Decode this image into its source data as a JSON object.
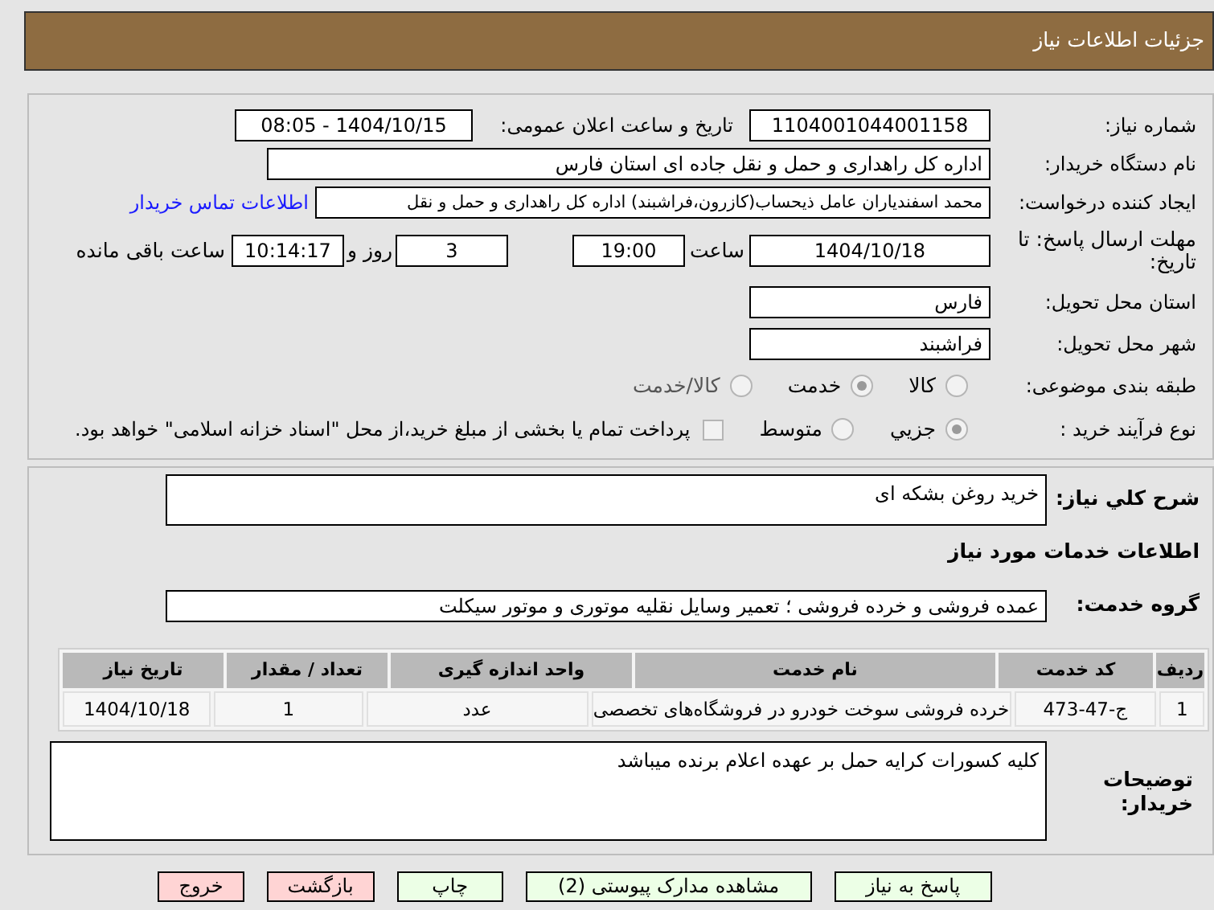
{
  "header": {
    "title": "جزئیات اطلاعات نیاز"
  },
  "need_number": {
    "label": "شماره نیاز:",
    "value": "1104001044001158"
  },
  "announce": {
    "label": "تاریخ و ساعت اعلان عمومی:",
    "value": "1404/10/15 - 08:05"
  },
  "buyer_org": {
    "label": "نام دستگاه خریدار:",
    "value": "اداره کل راهداری و حمل و نقل جاده ای استان فارس"
  },
  "requester": {
    "label": "ایجاد کننده درخواست:",
    "value": "محمد اسفندیاران عامل ذیحساب(کازرون،فراشبند) اداره کل راهداری و حمل و نقل",
    "link": "اطلاعات تماس خریدار"
  },
  "deadline": {
    "label": "مهلت ارسال پاسخ: تا تاریخ:",
    "date": "1404/10/18",
    "time_label": "ساعت",
    "time": "19:00",
    "days": "3",
    "days_label": "روز و",
    "remaining": "10:14:17",
    "remaining_label": "ساعت باقی مانده"
  },
  "province": {
    "label": "استان محل تحویل:",
    "value": "فارس"
  },
  "city": {
    "label": "شهر محل تحویل:",
    "value": "فراشبند"
  },
  "category": {
    "label": "طبقه بندی موضوعی:",
    "options": [
      {
        "label": "کالا",
        "selected": false,
        "disabled": false
      },
      {
        "label": "خدمت",
        "selected": true,
        "disabled": false
      },
      {
        "label": "کالا/خدمت",
        "selected": false,
        "disabled": true
      }
    ]
  },
  "process": {
    "label": "نوع فرآیند خرید :",
    "options": [
      {
        "label": "جزیي",
        "selected": true
      },
      {
        "label": "متوسط",
        "selected": false
      }
    ],
    "payment": {
      "label": "پرداخت تمام یا بخشی از مبلغ خرید،از محل \"اسناد خزانه اسلامی\" خواهد بود.",
      "checked": false
    }
  },
  "summary": {
    "label": "شرح کلي نياز:",
    "value": "خرید روغن بشکه ای"
  },
  "services_heading": "اطلاعات خدمات مورد نیاز",
  "service_group": {
    "label": "گروه خدمت:",
    "value": "عمده فروشی و خرده فروشی ؛ تعمیر وسایل نقلیه موتوری و موتور سیکلت"
  },
  "table": {
    "columns": [
      "ردیف",
      "کد خدمت",
      "نام خدمت",
      "واحد اندازه گیری",
      "تعداد / مقدار",
      "تاریخ نیاز"
    ],
    "rows": [
      [
        "1",
        "ج-47-473",
        "خرده فروشی سوخت خودرو در فروشگاه‌های تخصصی",
        "عدد",
        "1",
        "1404/10/18"
      ]
    ]
  },
  "buyer_notes": {
    "label": "توضیحات خریدار:",
    "value": "کلیه کسورات کرایه حمل بر عهده اعلام برنده میباشد"
  },
  "buttons": [
    {
      "label": "پاسخ به نیاز",
      "kind": "primary"
    },
    {
      "label": "مشاهده مدارک پیوستی (2)",
      "kind": "primary"
    },
    {
      "label": "چاپ",
      "kind": "primary"
    },
    {
      "label": "بازگشت",
      "kind": "danger"
    },
    {
      "label": "خروج",
      "kind": "danger"
    }
  ]
}
